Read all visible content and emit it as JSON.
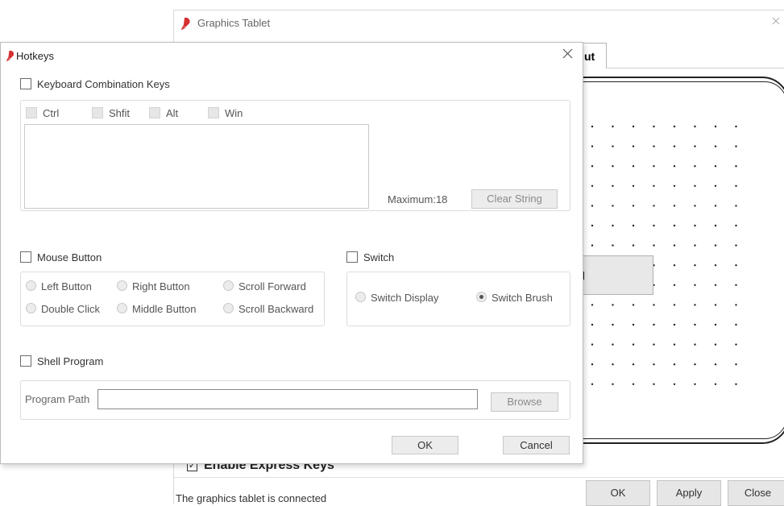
{
  "main_window": {
    "title": "Graphics Tablet",
    "tab_fragment": "ut",
    "gray_box_fragment": "l",
    "express_keys_label": "Enable Express Keys",
    "status": "The graphics tablet is connected",
    "buttons": {
      "ok": "OK",
      "apply": "Apply",
      "close": "Close"
    }
  },
  "dialog": {
    "title": "Hotkeys",
    "keyboard": {
      "label": "Keyboard Combination Keys",
      "modifiers": [
        "Ctrl",
        "Shfit",
        "Alt",
        "Win"
      ],
      "maximum": "Maximum:18",
      "clear_button": "Clear String"
    },
    "mouse": {
      "label": "Mouse Button",
      "options": [
        "Left Button",
        "Right Button",
        "Scroll Forward",
        "Double Click",
        "Middle Button",
        "Scroll Backward"
      ]
    },
    "switch": {
      "label": "Switch",
      "options": [
        "Switch Display",
        "Switch Brush"
      ],
      "selected": "Switch Brush"
    },
    "shell": {
      "label": "Shell Program",
      "path_label": "Program Path",
      "path_value": "",
      "browse_button": "Browse"
    },
    "buttons": {
      "ok": "OK",
      "cancel": "Cancel"
    }
  }
}
